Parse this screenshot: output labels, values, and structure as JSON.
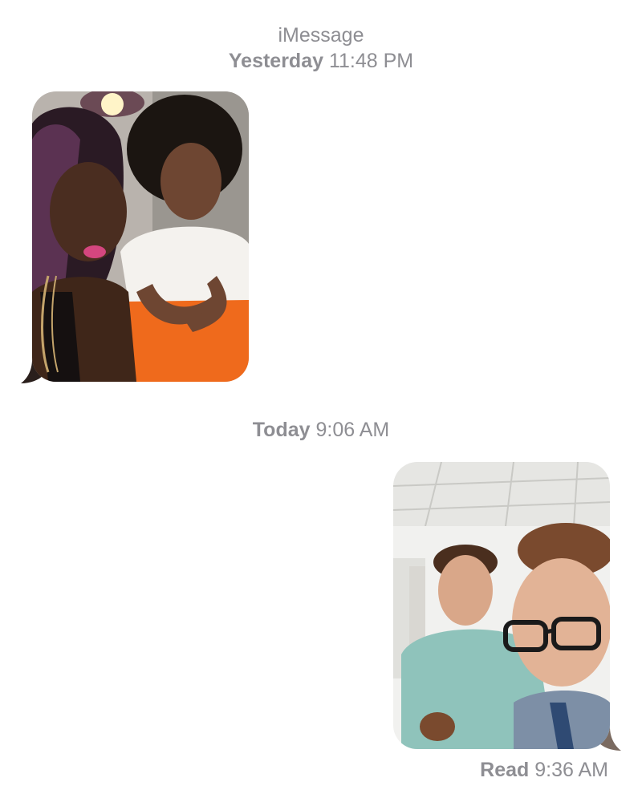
{
  "header": {
    "service": "iMessage",
    "first_day": "Yesterday",
    "first_time": "11:48 PM"
  },
  "messages": [
    {
      "direction": "incoming",
      "type": "photo",
      "subject": "selfie of two women at orange table"
    },
    {
      "direction": "outgoing",
      "type": "photo",
      "subject": "selfie of two men in office"
    }
  ],
  "second_group": {
    "day": "Today",
    "time": "9:06 AM"
  },
  "receipt": {
    "label": "Read",
    "time": "9:36 AM"
  },
  "colors": {
    "timestamp_gray": "#8e8e93",
    "background": "#ffffff"
  }
}
